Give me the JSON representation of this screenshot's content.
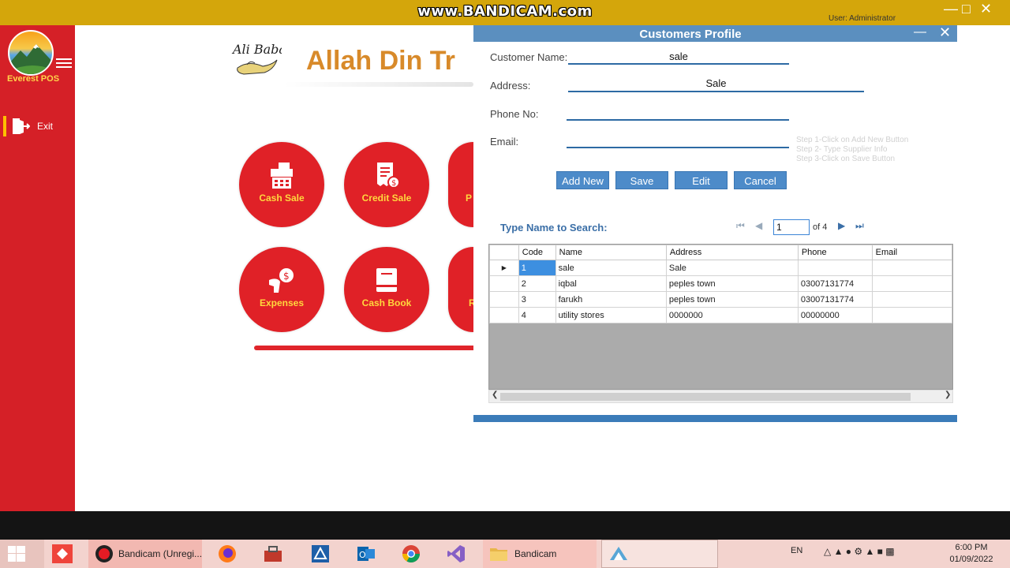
{
  "watermark": "www.BANDICAM.com",
  "window": {
    "user_label": "User: Administrator"
  },
  "sidebar": {
    "brand": "Everest POS",
    "exit_label": "Exit"
  },
  "dashboard": {
    "title": "Allah Din Tr",
    "logo_text": "Ali Baba",
    "tiles": [
      {
        "label": "Cash Sale",
        "icon": "cash-register-icon"
      },
      {
        "label": "Credit Sale",
        "icon": "credit-receipt-icon"
      },
      {
        "label": "P",
        "icon": "partial-tile"
      },
      {
        "label": "Expenses",
        "icon": "money-hand-icon"
      },
      {
        "label": "Cash Book",
        "icon": "book-icon"
      },
      {
        "label": "R",
        "icon": "partial-tile"
      }
    ],
    "accent": "#e02127"
  },
  "dialog": {
    "title": "Customers Profile",
    "fields": {
      "customer_name": {
        "label": "Customer Name:",
        "value": "sale"
      },
      "address": {
        "label": "Address:",
        "value": "Sale"
      },
      "phone": {
        "label": "Phone No:",
        "value": ""
      },
      "email": {
        "label": "Email:",
        "value": ""
      }
    },
    "hints": [
      "Step 1-Click on Add New Button",
      "Step 2- Type Supplier Info",
      "Step 3-Click on Save Button"
    ],
    "buttons": {
      "add_new": "Add New",
      "save": "Save",
      "edit": "Edit",
      "cancel": "Cancel"
    },
    "search_label": "Type Name to Search:",
    "pager": {
      "current": "1",
      "of_label": "of 4"
    },
    "grid": {
      "columns": [
        "Code",
        "Name",
        "Address",
        "Phone",
        "Email"
      ],
      "rows": [
        {
          "code": "1",
          "name": "sale",
          "address": "Sale",
          "phone": "",
          "email": ""
        },
        {
          "code": "2",
          "name": "iqbal",
          "address": "peples town",
          "phone": "03007131774",
          "email": ""
        },
        {
          "code": "3",
          "name": "farukh",
          "address": "peples town",
          "phone": "03007131774",
          "email": ""
        },
        {
          "code": "4",
          "name": "utility stores",
          "address": "0000000",
          "phone": "00000000",
          "email": ""
        }
      ]
    },
    "header_color": "#5b8fbf",
    "button_color": "#4d8bc9"
  },
  "taskbar": {
    "items": [
      {
        "label": "Bandicam (Unregi...",
        "icon": "bandicam-record-icon"
      },
      {
        "label": "",
        "icon": "firefox-icon"
      },
      {
        "label": "",
        "icon": "toolbox-icon"
      },
      {
        "label": "",
        "icon": "sql-icon"
      },
      {
        "label": "",
        "icon": "outlook-icon"
      },
      {
        "label": "",
        "icon": "chrome-icon"
      },
      {
        "label": "",
        "icon": "visual-studio-icon"
      },
      {
        "label": "Bandicam",
        "icon": "folder-icon"
      },
      {
        "label": "",
        "icon": "everest-pos-icon"
      }
    ],
    "lang": "EN",
    "time": "6:00 PM",
    "date": "01/09/2022"
  }
}
